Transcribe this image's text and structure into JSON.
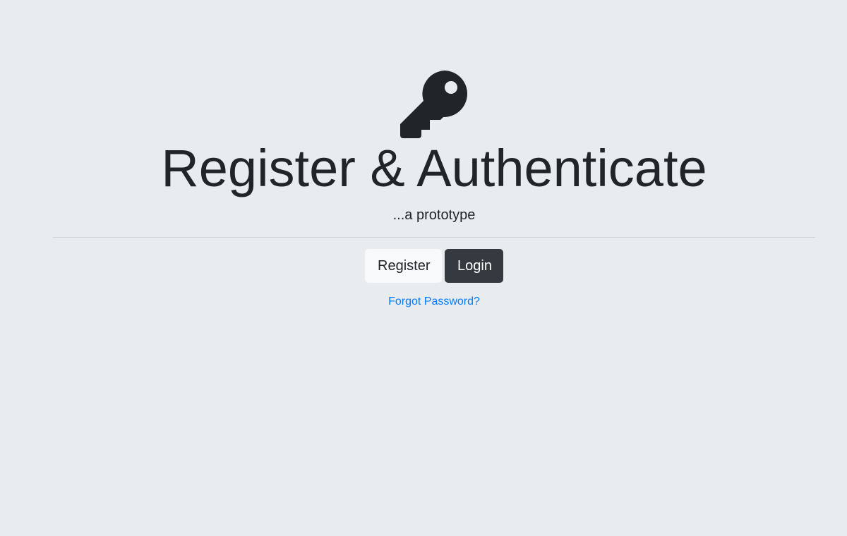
{
  "header": {
    "icon": "key-icon",
    "title": "Register & Authenticate",
    "subtitle": "...a prototype"
  },
  "actions": {
    "register_label": "Register",
    "login_label": "Login",
    "forgot_password_label": "Forgot Password?"
  },
  "colors": {
    "background": "#e9ecef",
    "text": "#212529",
    "register_button_bg": "#f8f9fa",
    "login_button_bg": "#343a40",
    "link": "#007bff"
  }
}
